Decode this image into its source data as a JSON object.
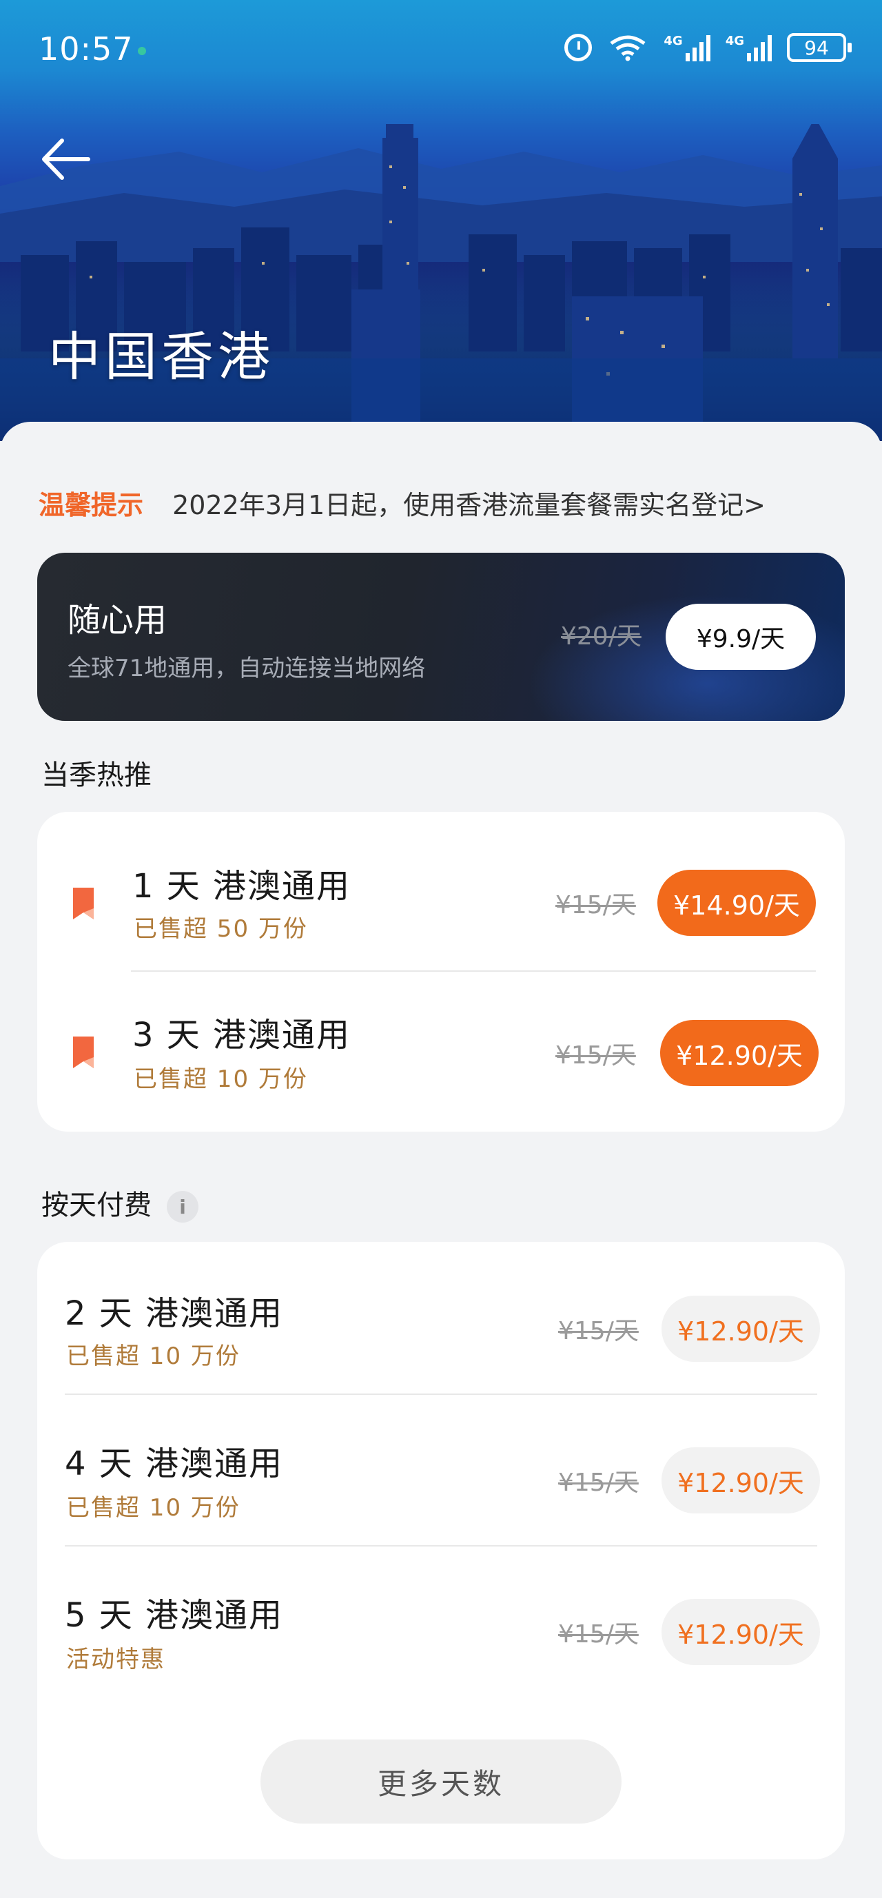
{
  "status_bar": {
    "time": "10:57",
    "network_1": "4G",
    "network_2": "4G",
    "battery": "94"
  },
  "header": {
    "title": "中国香港"
  },
  "notice": {
    "tag": "温馨提示",
    "text": "2022年3月1日起，使用香港流量套餐需实名登记>"
  },
  "promo": {
    "title": "随心用",
    "subtitle": "全球71地通用，自动连接当地网络",
    "original_price": "¥20/天",
    "price_button": "¥9.9/天"
  },
  "hot_section": {
    "title": "当季热推",
    "items": [
      {
        "name": "1 天 港澳通用",
        "sold": "已售超 50 万份",
        "original_price": "¥15/天",
        "price": "¥14.90/天"
      },
      {
        "name": "3 天 港澳通用",
        "sold": "已售超 10 万份",
        "original_price": "¥15/天",
        "price": "¥12.90/天"
      }
    ]
  },
  "daily_section": {
    "title": "按天付费",
    "info_icon": "i",
    "items": [
      {
        "name": "2 天 港澳通用",
        "sold": "已售超 10 万份",
        "original_price": "¥15/天",
        "price": "¥12.90/天"
      },
      {
        "name": "4 天 港澳通用",
        "sold": "已售超 10 万份",
        "original_price": "¥15/天",
        "price": "¥12.90/天"
      },
      {
        "name": "5 天 港澳通用",
        "sold": "活动特惠",
        "original_price": "¥15/天",
        "price": "¥12.90/天"
      }
    ],
    "more_button": "更多天数"
  },
  "colors": {
    "accent_orange": "#f26a1b",
    "sold_text": "#b07b3a",
    "notice_tag": "#f0662a"
  },
  "icons": [
    "alarm-icon",
    "wifi-icon",
    "signal-icon",
    "battery-icon",
    "back-arrow-icon",
    "bookmark-icon",
    "info-icon"
  ]
}
